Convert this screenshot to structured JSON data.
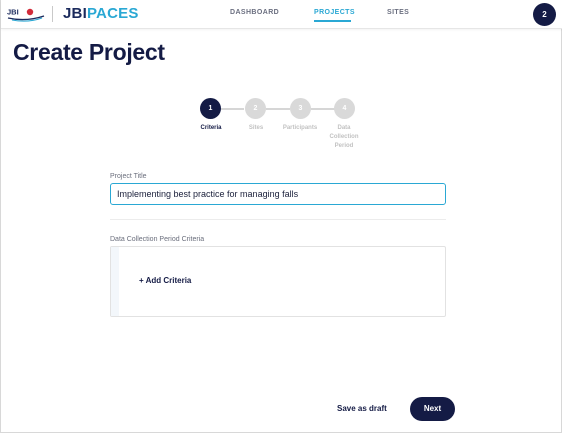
{
  "header": {
    "logo_text": "JBI",
    "brand_primary": "JBI",
    "brand_secondary": "PACES",
    "nav": [
      {
        "label": "DASHBOARD",
        "active": false
      },
      {
        "label": "PROJECTS",
        "active": true
      },
      {
        "label": "SITES",
        "active": false
      }
    ],
    "avatar_label": "2"
  },
  "page": {
    "title": "Create Project"
  },
  "stepper": {
    "steps": [
      {
        "number": "1",
        "label": "Criteria",
        "active": true
      },
      {
        "number": "2",
        "label": "Sites",
        "active": false
      },
      {
        "number": "3",
        "label": "Participants",
        "active": false
      },
      {
        "number": "4",
        "label": "Data Collection Period",
        "active": false
      }
    ]
  },
  "form": {
    "project_title_label": "Project Title",
    "project_title_value": "Implementing best practice for managing falls",
    "criteria_label": "Data Collection Period Criteria",
    "add_criteria_label": "+ Add Criteria"
  },
  "footer": {
    "save_draft_label": "Save as draft",
    "next_label": "Next"
  },
  "colors": {
    "navy": "#141b45",
    "accent": "#2aa8d4",
    "inactive": "#d9d9d9"
  }
}
